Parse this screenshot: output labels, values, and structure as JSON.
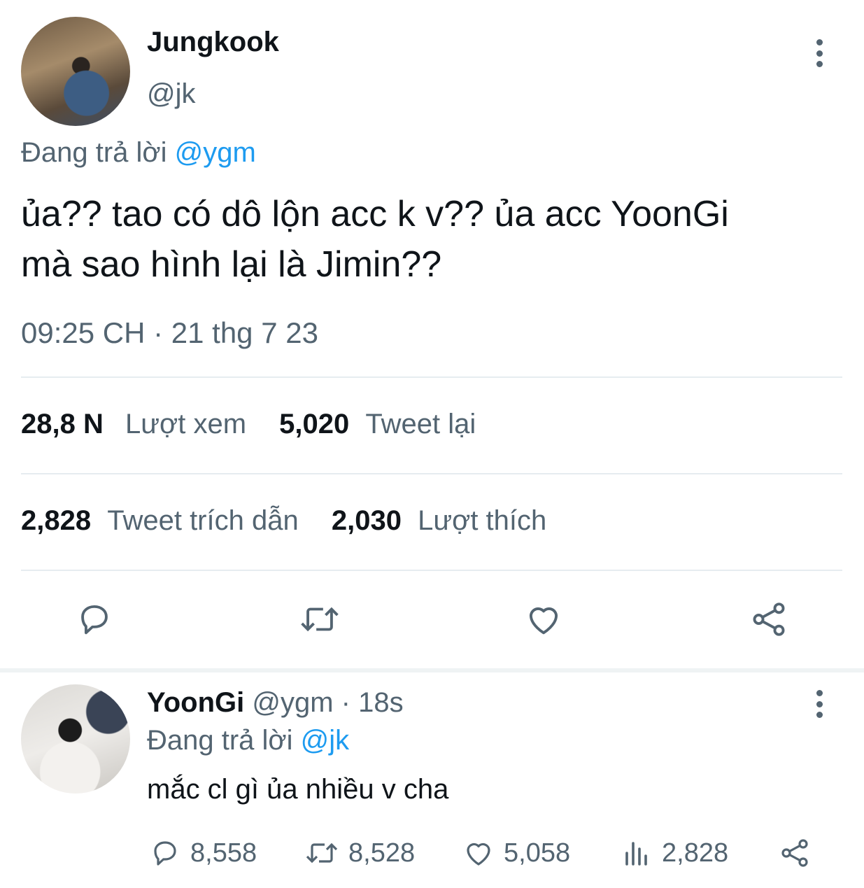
{
  "main_tweet": {
    "author_name": "Jungkook",
    "author_handle": "@jk",
    "replying_prefix": "Đang trả lời",
    "replying_to": "@ygm",
    "text_line1": "ủa?? tao có dô lộn acc k v?? ủa acc YoonGi",
    "text_line2": "mà sao hình lại là Jimin??",
    "timestamp": "09:25 CH · 21 thg 7 23",
    "views_count": "28,8 N",
    "views_label": "Lượt xem",
    "retweets_count": "5,020",
    "retweets_label": "Tweet lại",
    "quotes_count": "2,828",
    "quotes_label": "Tweet trích dẫn",
    "likes_count": "2,030",
    "likes_label": "Lượt thích"
  },
  "reply_tweet": {
    "author_name": "YoonGi",
    "author_handle": "@ygm",
    "separator": "·",
    "time_ago": "18s",
    "replying_prefix": "Đang trả lời",
    "replying_to": "@jk",
    "text": "mắc cl gì ủa nhiều v cha",
    "replies": "8,558",
    "retweets": "8,528",
    "likes": "5,058",
    "views": "2,828"
  },
  "icons": {
    "reply": "reply-icon",
    "retweet": "retweet-icon",
    "like": "heart-icon",
    "share": "share-icon",
    "views": "views-icon",
    "more": "more-vertical-icon"
  },
  "colors": {
    "text": "#0f1419",
    "muted": "#536471",
    "mention": "#1d9bf0",
    "divider": "#e6ecf0"
  }
}
